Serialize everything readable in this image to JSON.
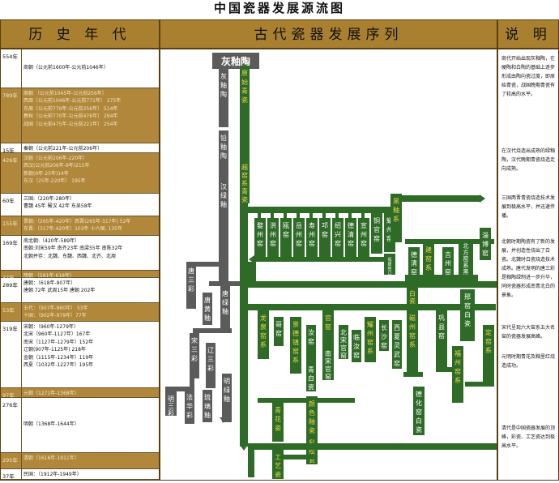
{
  "title": "中国瓷器发展源流图",
  "headers": {
    "history": "历 史 年 代",
    "sequence": "古代瓷器发展序列",
    "notes": "说 明"
  },
  "periods": [
    {
      "years": "554年",
      "dark": false,
      "lines": [
        "商朝（公元前1600年-公元前1046年）"
      ]
    },
    {
      "years": "789年",
      "dark": true,
      "lines": [
        "周朝 （公元前1045年-公元前256年）",
        "西周（公元前1046年-公元前771年） 275年",
        "东周（公元前770年-公元前256年） 514年",
        "春秋（公元前770年-公元前476年） 294年",
        "战国（公元前475年-公元前221年） 254年"
      ]
    },
    {
      "years": "15年",
      "dark": false,
      "lines": [
        "秦朝（公元前221年-公元前206年）"
      ]
    },
    {
      "years": "426年",
      "dark": true,
      "lines": [
        "汉朝（公元前206年-220年）",
        "西汉(公元前206年-9年)215年",
        "新朝(9年-23年)14年",
        "东汉（25年-220年） 195年"
      ]
    },
    {
      "years": "60年",
      "dark": false,
      "lines": [
        "三国:（220年-280年）",
        "曹魏 45年 蜀汉 42年 东吴58年"
      ]
    },
    {
      "years": "155年",
      "dark": true,
      "lines": [
        "晋朝:（265年-420年）西晋(265年-317年) 52年",
        "东晋:（317年-420年）103年 十六国: 135年"
      ]
    },
    {
      "years": "169年",
      "dark": false,
      "lines": [
        "南北朝:（420年-589年）",
        "南朝:刘宋59年 南齐23年 南梁55年 南陈32年",
        "北朝并存：北魏、东魏、西魏、北齐、北周"
      ]
    },
    {
      "years": "37年",
      "dark": true,
      "lines": [
        "隋朝 （581年-618年）"
      ]
    },
    {
      "years": "289年",
      "dark": false,
      "lines": [
        "唐朝：（618年-907年）",
        "唐朝 72年 武周15年 唐朝 202年"
      ]
    },
    {
      "years": "53年",
      "dark": true,
      "lines": [
        "五代：（907年-960年） 53年",
        "十国：（902年-979年）77年"
      ]
    },
    {
      "years": "319年",
      "dark": false,
      "lines": [
        "宋朝：（960年-1279年）",
        "北宋（960年-1127年）167年",
        "南宋（1127年-1279年）152年",
        "辽朝(907年-1125年) 218年",
        "金朝（1115年-1234年）119年",
        "西夏（1032年-1227年）195年"
      ]
    },
    {
      "years": "97年",
      "dark": true,
      "lines": [
        "元朝（1271年-1368年）"
      ]
    },
    {
      "years": "276年",
      "dark": false,
      "lines": [
        "明朝（1368年-1644年）"
      ]
    },
    {
      "years": "295年",
      "dark": true,
      "lines": [
        "清朝（1616年-1911年）"
      ]
    },
    {
      "years": "37年",
      "dark": false,
      "lines": [
        "民国：（1912年-1949年）"
      ]
    }
  ],
  "notes": [
    "商代开始出现灰釉陶，在硬陶和白陶的基础上逐步形成由陶向瓷过度，即原始青瓷，战国晚期青瓷有了较高的水平。",
    "在汉代烧造出成熟的绿釉陶，汉代晚期青瓷烧造走向成熟。",
    "三国两晋青瓷烧造技术发展到极高水平，并迅速传播。",
    "北朝时期陶瓷有了新的发展，并创造性烧出了白瓷。北魏时白瓷烧造技术成熟。唐代发明的唐三彩是釉陶绿制进一步升华，同时瓷器形成南青北白的景象。",
    "宋代呈现六大窑系五大名窑的瓷器发展高峰。",
    "元明时期青花及釉里红烧造成功。",
    "清代是中国瓷器发展的顶峰，彩瓷、工艺瓷达到极高水平。"
  ],
  "diagram": {
    "root": "灰釉陶",
    "gray_labels": [
      "灰釉陶",
      "铅釉陶",
      "汉绿釉",
      "唐三彩",
      "唐黄釉",
      "唐绿釉",
      "宋三彩",
      "辽三彩",
      "明三彩",
      "法华彩",
      "琉璃釉",
      "明绿釉"
    ],
    "green_labels": [
      "原始青瓷",
      "越窑系青瓷",
      "婺州窑",
      "洪州窑",
      "瓯窑",
      "岳州窑",
      "寿州窑",
      "邛窑",
      "绍兴窑",
      "德清窑",
      "宣州窑",
      "铜官窑",
      "耀州窑",
      "福建窑口",
      "黑釉系",
      "德清窑",
      "建窑系",
      "吉州窑",
      "北方窑系黑釉",
      "淄博窑",
      "白瓷",
      "龙泉窑系",
      "哥窑",
      "景德镇窑系",
      "汝窑",
      "青白瓷",
      "官窑",
      "北宋官窑",
      "南宋官窑",
      "临汝窑",
      "耀州窑系",
      "长沙窑",
      "西夏灵武窑",
      "磁州窑系",
      "德化窑白瓷",
      "巩县窑",
      "定窑系",
      "邢窑白瓷",
      "福州窑系",
      "青花瓷",
      "颜色釉瓷",
      "彩绘瓷",
      "工艺瓷"
    ]
  }
}
